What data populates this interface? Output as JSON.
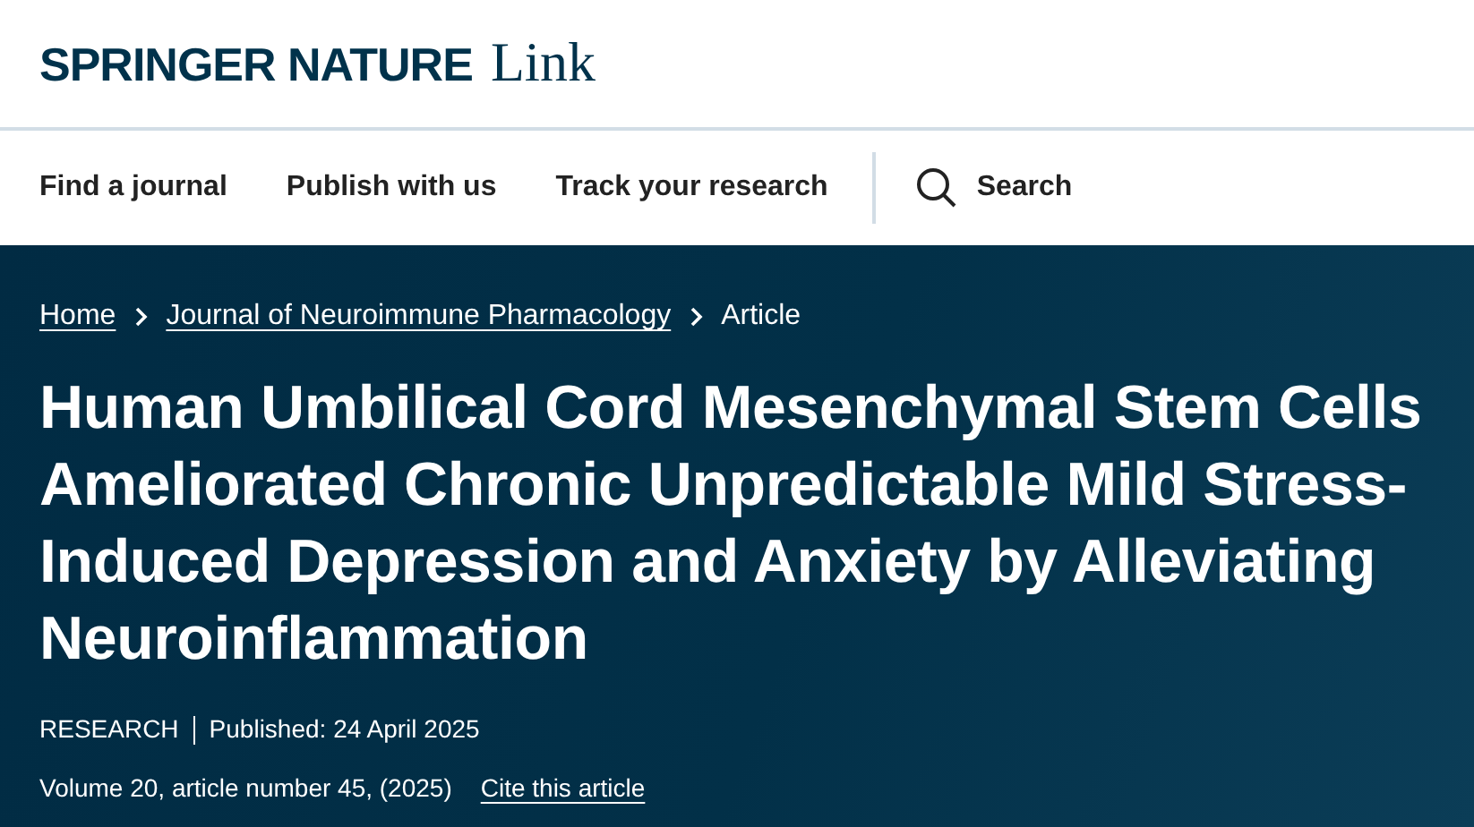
{
  "logo": {
    "brand": "SPRINGER NATURE",
    "product": "Link"
  },
  "nav": {
    "items": [
      "Find a journal",
      "Publish with us",
      "Track your research"
    ],
    "search": "Search"
  },
  "breadcrumbs": {
    "items": [
      "Home",
      "Journal of Neuroimmune Pharmacology"
    ],
    "current": "Article"
  },
  "article": {
    "title": "Human Umbilical Cord Mesenchymal Stem Cells Ameliorated Chronic Unpredictable Mild Stress-Induced Depression and Anxiety by Alleviating Neuroinflammation",
    "type": "RESEARCH",
    "published": "Published: 24 April 2025",
    "citation": "Volume 20, article number 45, (2025)",
    "cite_link": "Cite this article"
  }
}
